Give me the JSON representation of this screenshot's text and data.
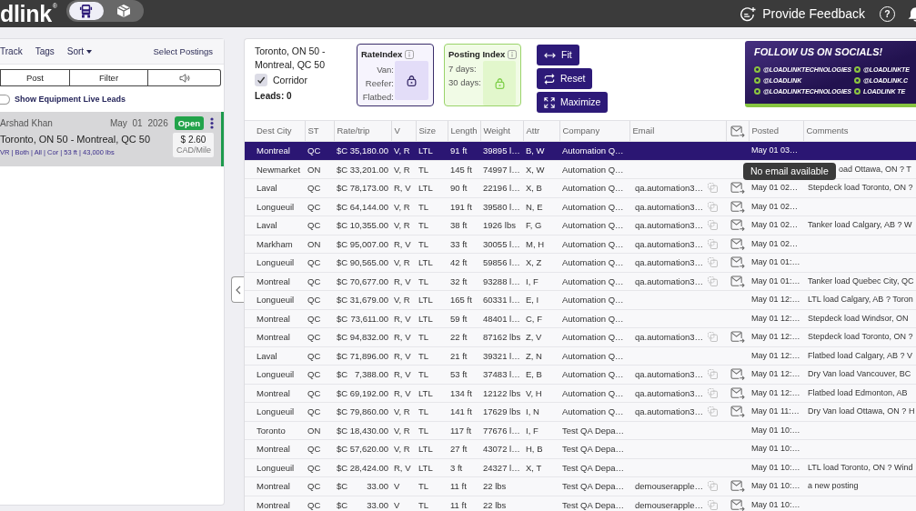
{
  "topbar": {
    "logo": "dlink$^{®}$",
    "modes": [
      {
        "kind": "truck",
        "selected": true
      },
      {
        "kind": "box",
        "selected": false
      }
    ],
    "feedback": "Provide Feedback",
    "help": "?"
  },
  "left_panel": {
    "toolbar": [
      {
        "kind": "link",
        "label": "Track"
      },
      {
        "kind": "link",
        "label": "Tags"
      },
      {
        "kind": "dropdown",
        "label": "Sort"
      },
      {
        "kind": "action",
        "label": "Select Postings"
      }
    ],
    "segments": [
      {
        "kind": "text",
        "label": "Post"
      },
      {
        "kind": "text",
        "label": "Filter"
      },
      {
        "kind": "sound"
      }
    ],
    "live_leads": {
      "label": "Show Equipment Live Leads",
      "on": false
    },
    "postings": [
      {
        "name": "Arshad Khan",
        "date": "May 01 2026",
        "status": "Open",
        "route": "Toronto, ON 50 - Montreal, QC 50",
        "details": "VR | Both | All | Cor | 53 ft | 43,000 lbs",
        "rate": "$ 2.60",
        "rate_unit": "CAD/Mile",
        "selected": true
      }
    ]
  },
  "search": {
    "route": "Toronto, ON 50 - Montreal, QC 50",
    "corridor": {
      "label": "Corridor",
      "checked": true
    },
    "leads": "Leads: 0"
  },
  "rate_index": {
    "title": "RateIndex",
    "labels": [
      "Van:",
      "Reefer:",
      "Flatbed:"
    ]
  },
  "posting_index": {
    "title": "Posting Index",
    "labels": [
      "7 days:",
      "30 days:"
    ]
  },
  "actions": [
    {
      "kind": "fit",
      "label": "Fit"
    },
    {
      "kind": "reset",
      "label": "Reset"
    },
    {
      "kind": "maximize",
      "label": "Maximize"
    }
  ],
  "social_banner": {
    "title": "FOLLOW US ON SOCIALS!",
    "handles": [
      "@LOADLINKTECHNOLOGIES",
      "@LOADLINK",
      "@LOADLINKTECHNOLOGIES",
      "@LOADLINKTE",
      "@LOADLINK.C",
      "LOADLINK TE"
    ]
  },
  "table": {
    "columns": [
      {
        "kind": "text",
        "label": "Dest City"
      },
      {
        "kind": "text",
        "label": "ST"
      },
      {
        "kind": "text",
        "label": "Rate/trip"
      },
      {
        "kind": "text",
        "label": "V"
      },
      {
        "kind": "text",
        "label": "Size"
      },
      {
        "kind": "text",
        "label": "Length"
      },
      {
        "kind": "text",
        "label": "Weight"
      },
      {
        "kind": "text",
        "label": "Attr"
      },
      {
        "kind": "text",
        "label": "Company"
      },
      {
        "kind": "text",
        "label": "Email"
      },
      {
        "kind": "mail_icon"
      },
      {
        "kind": "text",
        "label": "Posted"
      },
      {
        "kind": "text",
        "label": "Comments"
      }
    ],
    "rows": [
      {
        "city": "Montreal",
        "st": "QC",
        "currency": "$C",
        "amount": "35,180.00",
        "v": "V, R",
        "size": "LTL",
        "length": "91 ft",
        "weight": "39895 l…",
        "attr": "B, W",
        "company": "Automation Q…",
        "posted": "May 01 03…",
        "selected": true
      },
      {
        "city": "Newmarket",
        "st": "ON",
        "currency": "$C",
        "amount": "33,201.00",
        "v": "V, R",
        "size": "TL",
        "length": "145 ft",
        "weight": "74997 l…",
        "attr": "X, W",
        "company": "Automation Q…",
        "tooltip": "No email available",
        "comments": "oad Ottawa, ON ? T",
        "selected": false
      },
      {
        "city": "Laval",
        "st": "QC",
        "currency": "$C",
        "amount": "78,173.00",
        "v": "R, V",
        "size": "LTL",
        "length": "90 ft",
        "weight": "22196 l…",
        "attr": "X, B",
        "company": "Automation Q…",
        "email": "qa.automation3…",
        "posted": "May 01 02…",
        "comments": "Stepdeck load Toronto, ON ?",
        "selected": false
      },
      {
        "city": "Longueuil",
        "st": "QC",
        "currency": "$C",
        "amount": "64,144.00",
        "v": "V, R",
        "size": "TL",
        "length": "191 ft",
        "weight": "39580 l…",
        "attr": "N, E",
        "company": "Automation Q…",
        "email": "qa.automation3…",
        "posted": "May 01 02…",
        "selected": false
      },
      {
        "city": "Laval",
        "st": "QC",
        "currency": "$C",
        "amount": "10,355.00",
        "v": "V, R",
        "size": "TL",
        "length": "38 ft",
        "weight": "1926 lbs",
        "attr": "F, G",
        "company": "Automation Q…",
        "email": "qa.automation3…",
        "posted": "May 01 02…",
        "comments": "Tanker load Calgary, AB ? W",
        "selected": false
      },
      {
        "city": "Markham",
        "st": "ON",
        "currency": "$C",
        "amount": "95,007.00",
        "v": "R, V",
        "size": "TL",
        "length": "33 ft",
        "weight": "30055 l…",
        "attr": "M, H",
        "company": "Automation Q…",
        "email": "qa.automation3…",
        "posted": "May 01 02…",
        "selected": false
      },
      {
        "city": "Longueuil",
        "st": "QC",
        "currency": "$C",
        "amount": "90,565.00",
        "v": "V, R",
        "size": "LTL",
        "length": "42 ft",
        "weight": "59856 l…",
        "attr": "X, Z",
        "company": "Automation Q…",
        "email": "qa.automation3…",
        "posted": "May 01 01:…",
        "selected": false
      },
      {
        "city": "Montreal",
        "st": "QC",
        "currency": "$C",
        "amount": "70,677.00",
        "v": "R, V",
        "size": "TL",
        "length": "32 ft",
        "weight": "93288 l…",
        "attr": "I, F",
        "company": "Automation Q…",
        "email": "qa.automation3…",
        "posted": "May 01 01:…",
        "comments": "Tanker load Quebec City, QC",
        "selected": false
      },
      {
        "city": "Longueuil",
        "st": "QC",
        "currency": "$C",
        "amount": "31,679.00",
        "v": "V, R",
        "size": "LTL",
        "length": "165 ft",
        "weight": "60331 l…",
        "attr": "E, I",
        "company": "Automation Q…",
        "posted": "May 01 12:…",
        "comments": "LTL load Calgary, AB ? Toron",
        "selected": false
      },
      {
        "city": "Montreal",
        "st": "QC",
        "currency": "$C",
        "amount": "73,611.00",
        "v": "R, V",
        "size": "LTL",
        "length": "59 ft",
        "weight": "48401 l…",
        "attr": "C, F",
        "company": "Automation Q…",
        "posted": "May 01 12:…",
        "comments": "Stepdeck load Windsor, ON",
        "selected": false
      },
      {
        "city": "Montreal",
        "st": "QC",
        "currency": "$C",
        "amount": "94,832.00",
        "v": "R, V",
        "size": "TL",
        "length": "22 ft",
        "weight": "87162 lbs",
        "attr": "Z, V",
        "company": "Automation Q…",
        "email": "qa.automation3…",
        "posted": "May 01 12:…",
        "comments": "Stepdeck load Toronto, ON ?",
        "selected": false
      },
      {
        "city": "Laval",
        "st": "QC",
        "currency": "$C",
        "amount": "71,896.00",
        "v": "R, V",
        "size": "TL",
        "length": "21 ft",
        "weight": "39321 l…",
        "attr": "Z, N",
        "company": "Automation Q…",
        "posted": "May 01 12:…",
        "comments": "Flatbed load Calgary, AB ? V",
        "selected": false
      },
      {
        "city": "Longueuil",
        "st": "QC",
        "currency": "$C",
        "amount": "7,388.00",
        "v": "R, V",
        "size": "TL",
        "length": "53 ft",
        "weight": "37483 l…",
        "attr": "E, B",
        "company": "Automation Q…",
        "email": "qa.automation3…",
        "posted": "May 01 12:…",
        "comments": "Dry Van load Vancouver, BC",
        "selected": false
      },
      {
        "city": "Montreal",
        "st": "QC",
        "currency": "$C",
        "amount": "69,192.00",
        "v": "R, V",
        "size": "LTL",
        "length": "134 ft",
        "weight": "12122 lbs",
        "attr": "V, H",
        "company": "Automation Q…",
        "email": "qa.automation3…",
        "posted": "May 01 12:…",
        "comments": "Flatbed load Edmonton, AB",
        "selected": false
      },
      {
        "city": "Longueuil",
        "st": "QC",
        "currency": "$C",
        "amount": "79,860.00",
        "v": "V, R",
        "size": "TL",
        "length": "141 ft",
        "weight": "17629 lbs",
        "attr": "I, N",
        "company": "Automation Q…",
        "email": "qa.automation3…",
        "posted": "May 01 11:…",
        "comments": "Dry Van load Ottawa, ON ? H",
        "selected": false
      },
      {
        "city": "Toronto",
        "st": "ON",
        "currency": "$C",
        "amount": "18,430.00",
        "v": "V, R",
        "size": "TL",
        "length": "117 ft",
        "weight": "77676 l…",
        "attr": "I, F",
        "company": "Test QA Depa…",
        "posted": "May 01 10:…",
        "selected": false
      },
      {
        "city": "Montreal",
        "st": "QC",
        "currency": "$C",
        "amount": "57,620.00",
        "v": "V, R",
        "size": "LTL",
        "length": "27 ft",
        "weight": "43072 l…",
        "attr": "H, B",
        "company": "Test QA Depa…",
        "posted": "May 01 10:…",
        "selected": false
      },
      {
        "city": "Longueuil",
        "st": "QC",
        "currency": "$C",
        "amount": "28,424.00",
        "v": "R, V",
        "size": "LTL",
        "length": "3 ft",
        "weight": "24327 l…",
        "attr": "X, T",
        "company": "Test QA Depa…",
        "posted": "May 01 10:…",
        "comments": "LTL load Toronto, ON ? Wind",
        "selected": false
      },
      {
        "city": "Montreal",
        "st": "QC",
        "currency": "$C",
        "amount": "33.00",
        "v": "V",
        "size": "TL",
        "length": "11 ft",
        "weight": "22 lbs",
        "company": "Test QA Depa…",
        "email": "demouserapple…",
        "posted": "May 01 10:…",
        "comments": "a new posting",
        "selected": false
      },
      {
        "city": "Montreal",
        "st": "QC",
        "currency": "$C",
        "amount": "33.00",
        "v": "V",
        "size": "TL",
        "length": "11 ft",
        "weight": "22 lbs",
        "company": "Test QA Depa…",
        "email": "demouserapple…",
        "posted": "May 01 10:…",
        "selected": false
      }
    ]
  }
}
